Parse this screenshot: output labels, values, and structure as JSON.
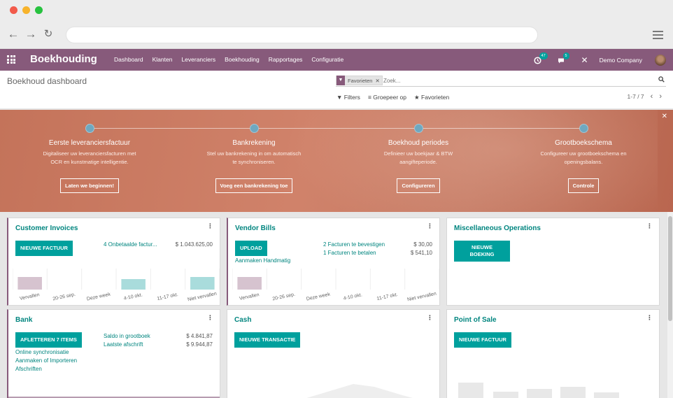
{
  "app": {
    "name": "Boekhouding",
    "menu": [
      "Dashboard",
      "Klanten",
      "Leveranciers",
      "Boekhouding",
      "Rapportages",
      "Configuratie"
    ],
    "activity_count": "47",
    "messages_count": "5",
    "company": "Demo Company",
    "brand_color": "#875a7b",
    "accent_color": "#00a09d"
  },
  "control_panel": {
    "breadcrumb": "Boekhoud dashboard",
    "facet": "Favorieten",
    "search_placeholder": "Zoek...",
    "filters": [
      "Filters",
      "Groepeer op",
      "Favorieten"
    ],
    "pager": "1-7 / 7"
  },
  "banner": {
    "steps": [
      {
        "title": "Eerste leveranciersfactuur",
        "desc": "Digitaliseer uw leveranciersfacturen met OCR en kunstmatige intelligentie.",
        "button": "Laten we beginnen!"
      },
      {
        "title": "Bankrekening",
        "desc": "Stel uw bankrekening in om automatisch te synchroniseren.",
        "button": "Voeg een bankrekening toe"
      },
      {
        "title": "Boekhoud periodes",
        "desc": "Definieer uw boekjaar & BTW aangifteperiode.",
        "button": "Configureren"
      },
      {
        "title": "Grootboekschema",
        "desc": "Configureer uw grootboekschema en openingsbalans.",
        "button": "Controle"
      }
    ]
  },
  "cards": {
    "customer_invoices": {
      "title": "Customer Invoices",
      "button": "NIEUWE FACTUUR",
      "line1_label": "4 Onbetaalde factur...",
      "line1_value": "$ 1.043.625,00"
    },
    "vendor_bills": {
      "title": "Vendor Bills",
      "button": "UPLOAD",
      "link": "Aanmaken Handmatig",
      "line1_label": "2 Facturen te bevestigen",
      "line1_value": "$ 30,00",
      "line2_label": "1 Facturen te betalen",
      "line2_value": "$ 541,10"
    },
    "misc": {
      "title": "Miscellaneous Operations",
      "button_line1": "NIEUWE",
      "button_line2": "BOEKING"
    },
    "bank": {
      "title": "Bank",
      "button": "AFLETTEREN 7 ITEMS",
      "links": [
        "Online synchronisatie",
        "Aanmaken of Importeren",
        "Afschriften"
      ],
      "line1_label": "Saldo in grootboek",
      "line1_value": "$ 4.841,87",
      "line2_label": "Laatste afschrift",
      "line2_value": "$ 9.944,87"
    },
    "cash": {
      "title": "Cash",
      "button": "NIEUWE TRANSACTIE"
    },
    "pos": {
      "title": "Point of Sale",
      "button": "NIEUWE FACTUUR"
    }
  },
  "chart_data": [
    {
      "type": "bar",
      "title": "Customer Invoices",
      "categories": [
        "Vervallen",
        "20-26 sep.",
        "Deze week",
        "4-10 okt.",
        "11-17 okt.",
        "Niet vervallen"
      ],
      "values": [
        0.6,
        0,
        0,
        0.5,
        0,
        0.6
      ],
      "colors": [
        "#d6c3cf",
        "#a9dcdc",
        "#a9dcdc",
        "#a9dcdc",
        "#a9dcdc",
        "#a9dcdc"
      ]
    },
    {
      "type": "bar",
      "title": "Vendor Bills",
      "categories": [
        "Vervallen",
        "20-26 sep.",
        "Deze week",
        "4-10 okt.",
        "11-17 okt.",
        "Niet vervallen"
      ],
      "values": [
        0.6,
        0,
        0,
        0,
        0,
        0
      ],
      "colors": [
        "#d6c3cf",
        "#a9dcdc",
        "#a9dcdc",
        "#a9dcdc",
        "#a9dcdc",
        "#a9dcdc"
      ]
    }
  ]
}
